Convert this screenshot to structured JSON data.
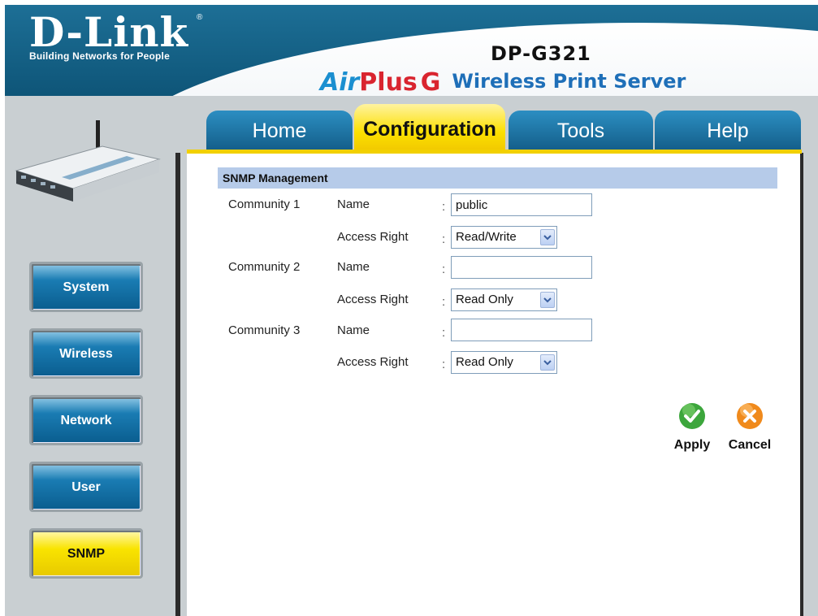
{
  "header": {
    "brand": "D-Link",
    "tagline": "Building Networks for People",
    "registered_mark": "®",
    "model": "DP-G321",
    "product_air": "Air",
    "product_plus": "Plus",
    "product_g": "G",
    "product_name": "Wireless Print Server"
  },
  "tabs": [
    {
      "label": "Home"
    },
    {
      "label": "Configuration",
      "active": true
    },
    {
      "label": "Tools"
    },
    {
      "label": "Help"
    }
  ],
  "sidebar": {
    "items": [
      {
        "label": "System"
      },
      {
        "label": "Wireless"
      },
      {
        "label": "Network"
      },
      {
        "label": "User"
      },
      {
        "label": "SNMP",
        "active": true
      }
    ]
  },
  "snmp": {
    "title": "SNMP Management",
    "name_label": "Name",
    "access_label": "Access Right",
    "colon": ":",
    "communities": [
      {
        "label": "Community 1",
        "name_value": "public",
        "access_value": "Read/Write"
      },
      {
        "label": "Community 2",
        "name_value": "",
        "access_value": "Read Only"
      },
      {
        "label": "Community 3",
        "name_value": "",
        "access_value": "Read Only"
      }
    ]
  },
  "actions": {
    "apply_label": "Apply",
    "cancel_label": "Cancel"
  },
  "colors": {
    "header_blue": "#0e5578",
    "tab_blue": "#135d88",
    "tab_active_yellow": "#fce000",
    "section_header": "#b6cbe9",
    "apply_green": "#3ca63c",
    "cancel_orange": "#f08a1c"
  },
  "icons": {
    "apply": "check-circle-icon",
    "cancel": "x-circle-icon",
    "select_arrow": "chevron-down-icon",
    "router": "router-device-icon"
  }
}
